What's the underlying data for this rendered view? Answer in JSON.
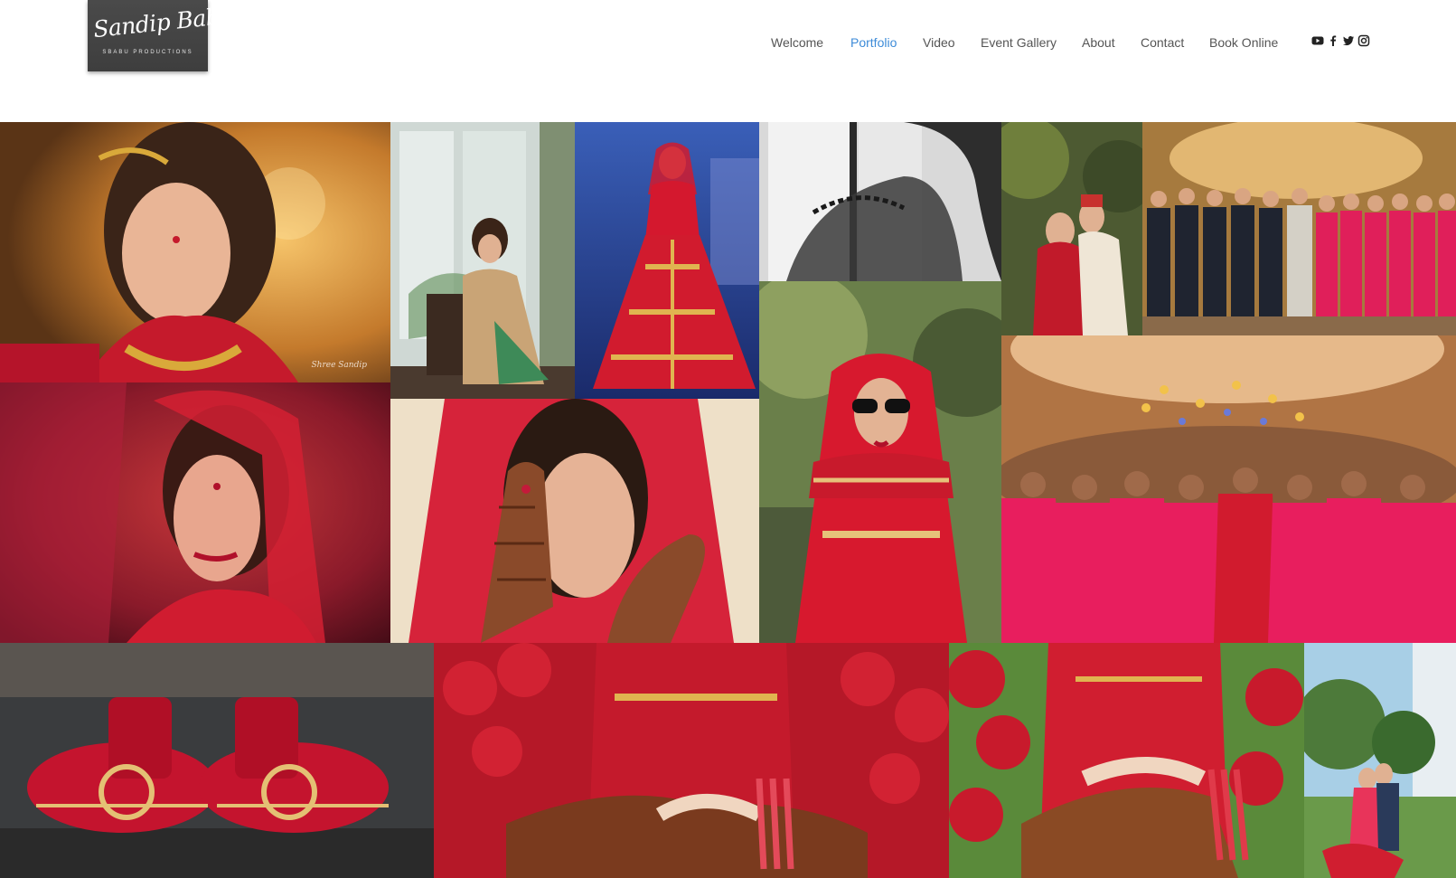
{
  "brand": {
    "logo_signature": "Sandip Babu",
    "logo_subtitle": "SBABU PRODUCTIONS"
  },
  "nav": {
    "items": [
      {
        "label": "Welcome",
        "active": false
      },
      {
        "label": "Portfolio",
        "active": true
      },
      {
        "label": "Video",
        "active": false
      },
      {
        "label": "Event Gallery",
        "active": false
      },
      {
        "label": "About",
        "active": false
      },
      {
        "label": "Contact",
        "active": false
      },
      {
        "label": "Book Online",
        "active": false
      }
    ],
    "active_color": "#3d8bd8",
    "text_color": "#555555"
  },
  "social": [
    "youtube-icon",
    "facebook-icon",
    "twitter-icon",
    "instagram-icon"
  ],
  "gallery": {
    "photo_subjects": [
      "bride-portrait-golden",
      "bride-seated-window",
      "bride-runway-red-lehenga",
      "bride-veil-silhouette-bw",
      "couple-garden",
      "groom-party-bridesmaids-group",
      "bride-eyes-closed",
      "bride-mehndi-hands",
      "bride-sunglasses",
      "bridesmaids-chandelier",
      "bridal-shoes",
      "couple-hands-ring-1",
      "couple-hands-ring-2",
      "couple-park-embrace"
    ]
  },
  "colors": {
    "accent": "#3d8bd8",
    "bridal_red": "#d4182e",
    "logo_bg": "#444444"
  }
}
